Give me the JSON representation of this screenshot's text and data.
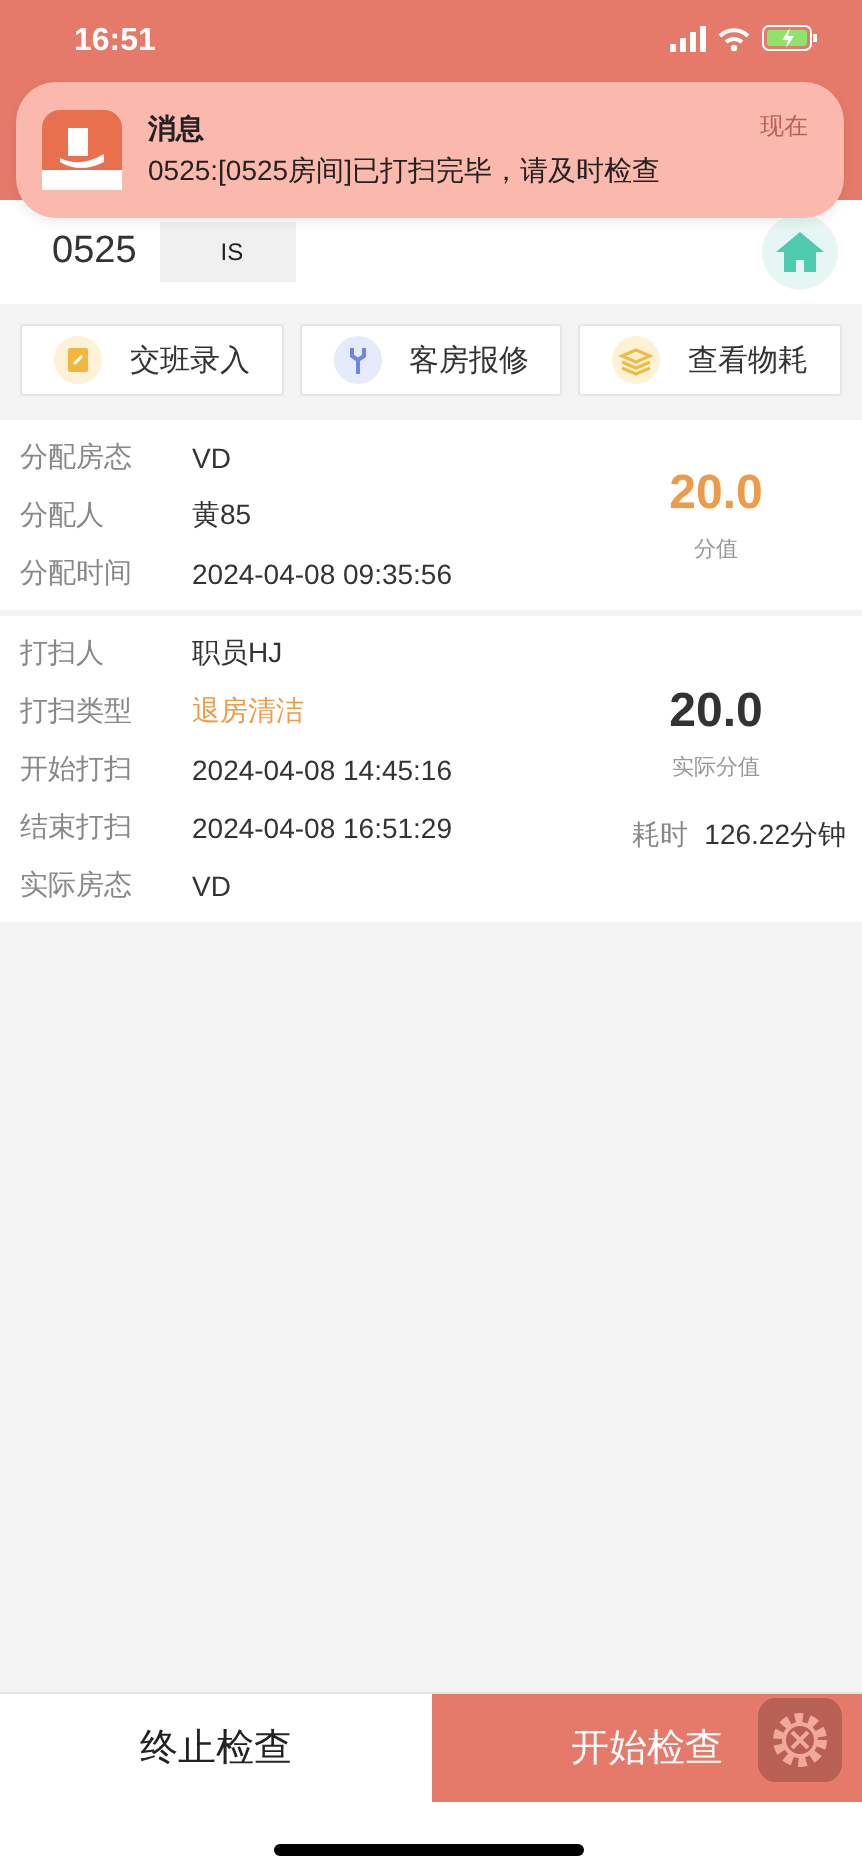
{
  "status_bar": {
    "time": "16:51"
  },
  "notification": {
    "title": "消息",
    "message": "0525:[0525房间]已打扫完毕，请及时检查",
    "time": "现在"
  },
  "room": {
    "number": "0525",
    "status": "IS"
  },
  "actions": [
    {
      "label": "交班录入",
      "kind": "clipboard"
    },
    {
      "label": "客房报修",
      "kind": "wrench"
    },
    {
      "label": "查看物耗",
      "kind": "layers"
    }
  ],
  "assignment": {
    "rows": [
      {
        "label": "分配房态",
        "value": "VD",
        "highlight": false
      },
      {
        "label": "分配人",
        "value": "黄85",
        "highlight": false
      },
      {
        "label": "分配时间",
        "value": "2024-04-08 09:35:56",
        "highlight": false
      }
    ],
    "score": "20.0",
    "score_label": "分值"
  },
  "cleaning": {
    "rows": [
      {
        "label": "打扫人",
        "value": "职员HJ",
        "highlight": false
      },
      {
        "label": "打扫类型",
        "value": "退房清洁",
        "highlight": true
      },
      {
        "label": "开始打扫",
        "value": "2024-04-08 14:45:16",
        "highlight": false
      },
      {
        "label": "结束打扫",
        "value": "2024-04-08 16:51:29",
        "highlight": false
      },
      {
        "label": "实际房态",
        "value": "VD",
        "highlight": false
      }
    ],
    "score": "20.0",
    "score_label": "实际分值",
    "duration_label": "耗时",
    "duration": "126.22分钟"
  },
  "bottom_buttons": [
    {
      "label": "终止检查",
      "kind": "secondary"
    },
    {
      "label": "开始检查",
      "kind": "primary"
    }
  ]
}
